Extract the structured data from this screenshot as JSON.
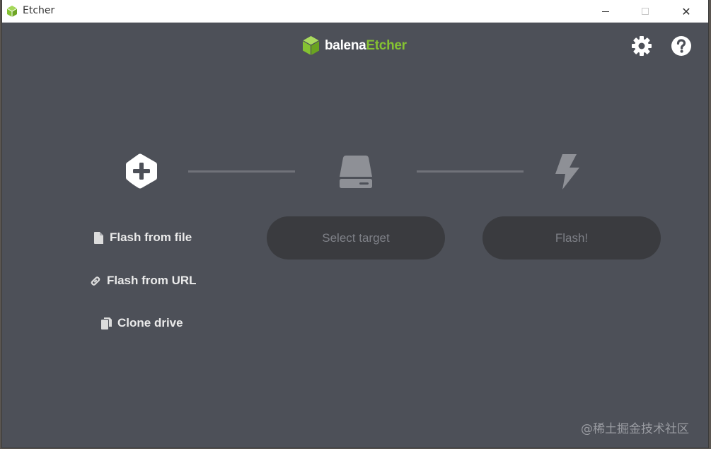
{
  "window": {
    "title": "Etcher",
    "controls": {
      "minimize_icon": "minimize-icon",
      "maximize_icon": "maximize-icon",
      "close_glyph": "✕"
    }
  },
  "header": {
    "brand_prefix": "balena",
    "brand_suffix": "Etcher",
    "settings_icon": "gear-icon",
    "help_icon": "question-circle-icon"
  },
  "steps": {
    "source_icon": "plus-hexagon-icon",
    "target_icon": "drive-icon",
    "flash_icon": "lightning-bolt-icon"
  },
  "source_options": [
    {
      "label": "Flash from file",
      "icon": "file-icon"
    },
    {
      "label": "Flash from URL",
      "icon": "link-icon"
    },
    {
      "label": "Clone drive",
      "icon": "copy-icon"
    }
  ],
  "buttons": {
    "select_target": "Select target",
    "flash": "Flash!"
  },
  "watermark": "@稀土掘金技术社区",
  "colors": {
    "background": "#4d5058",
    "accent": "#85c232",
    "button_bg": "#3a3b3f",
    "button_text": "#7e8087",
    "connector": "#707279"
  }
}
